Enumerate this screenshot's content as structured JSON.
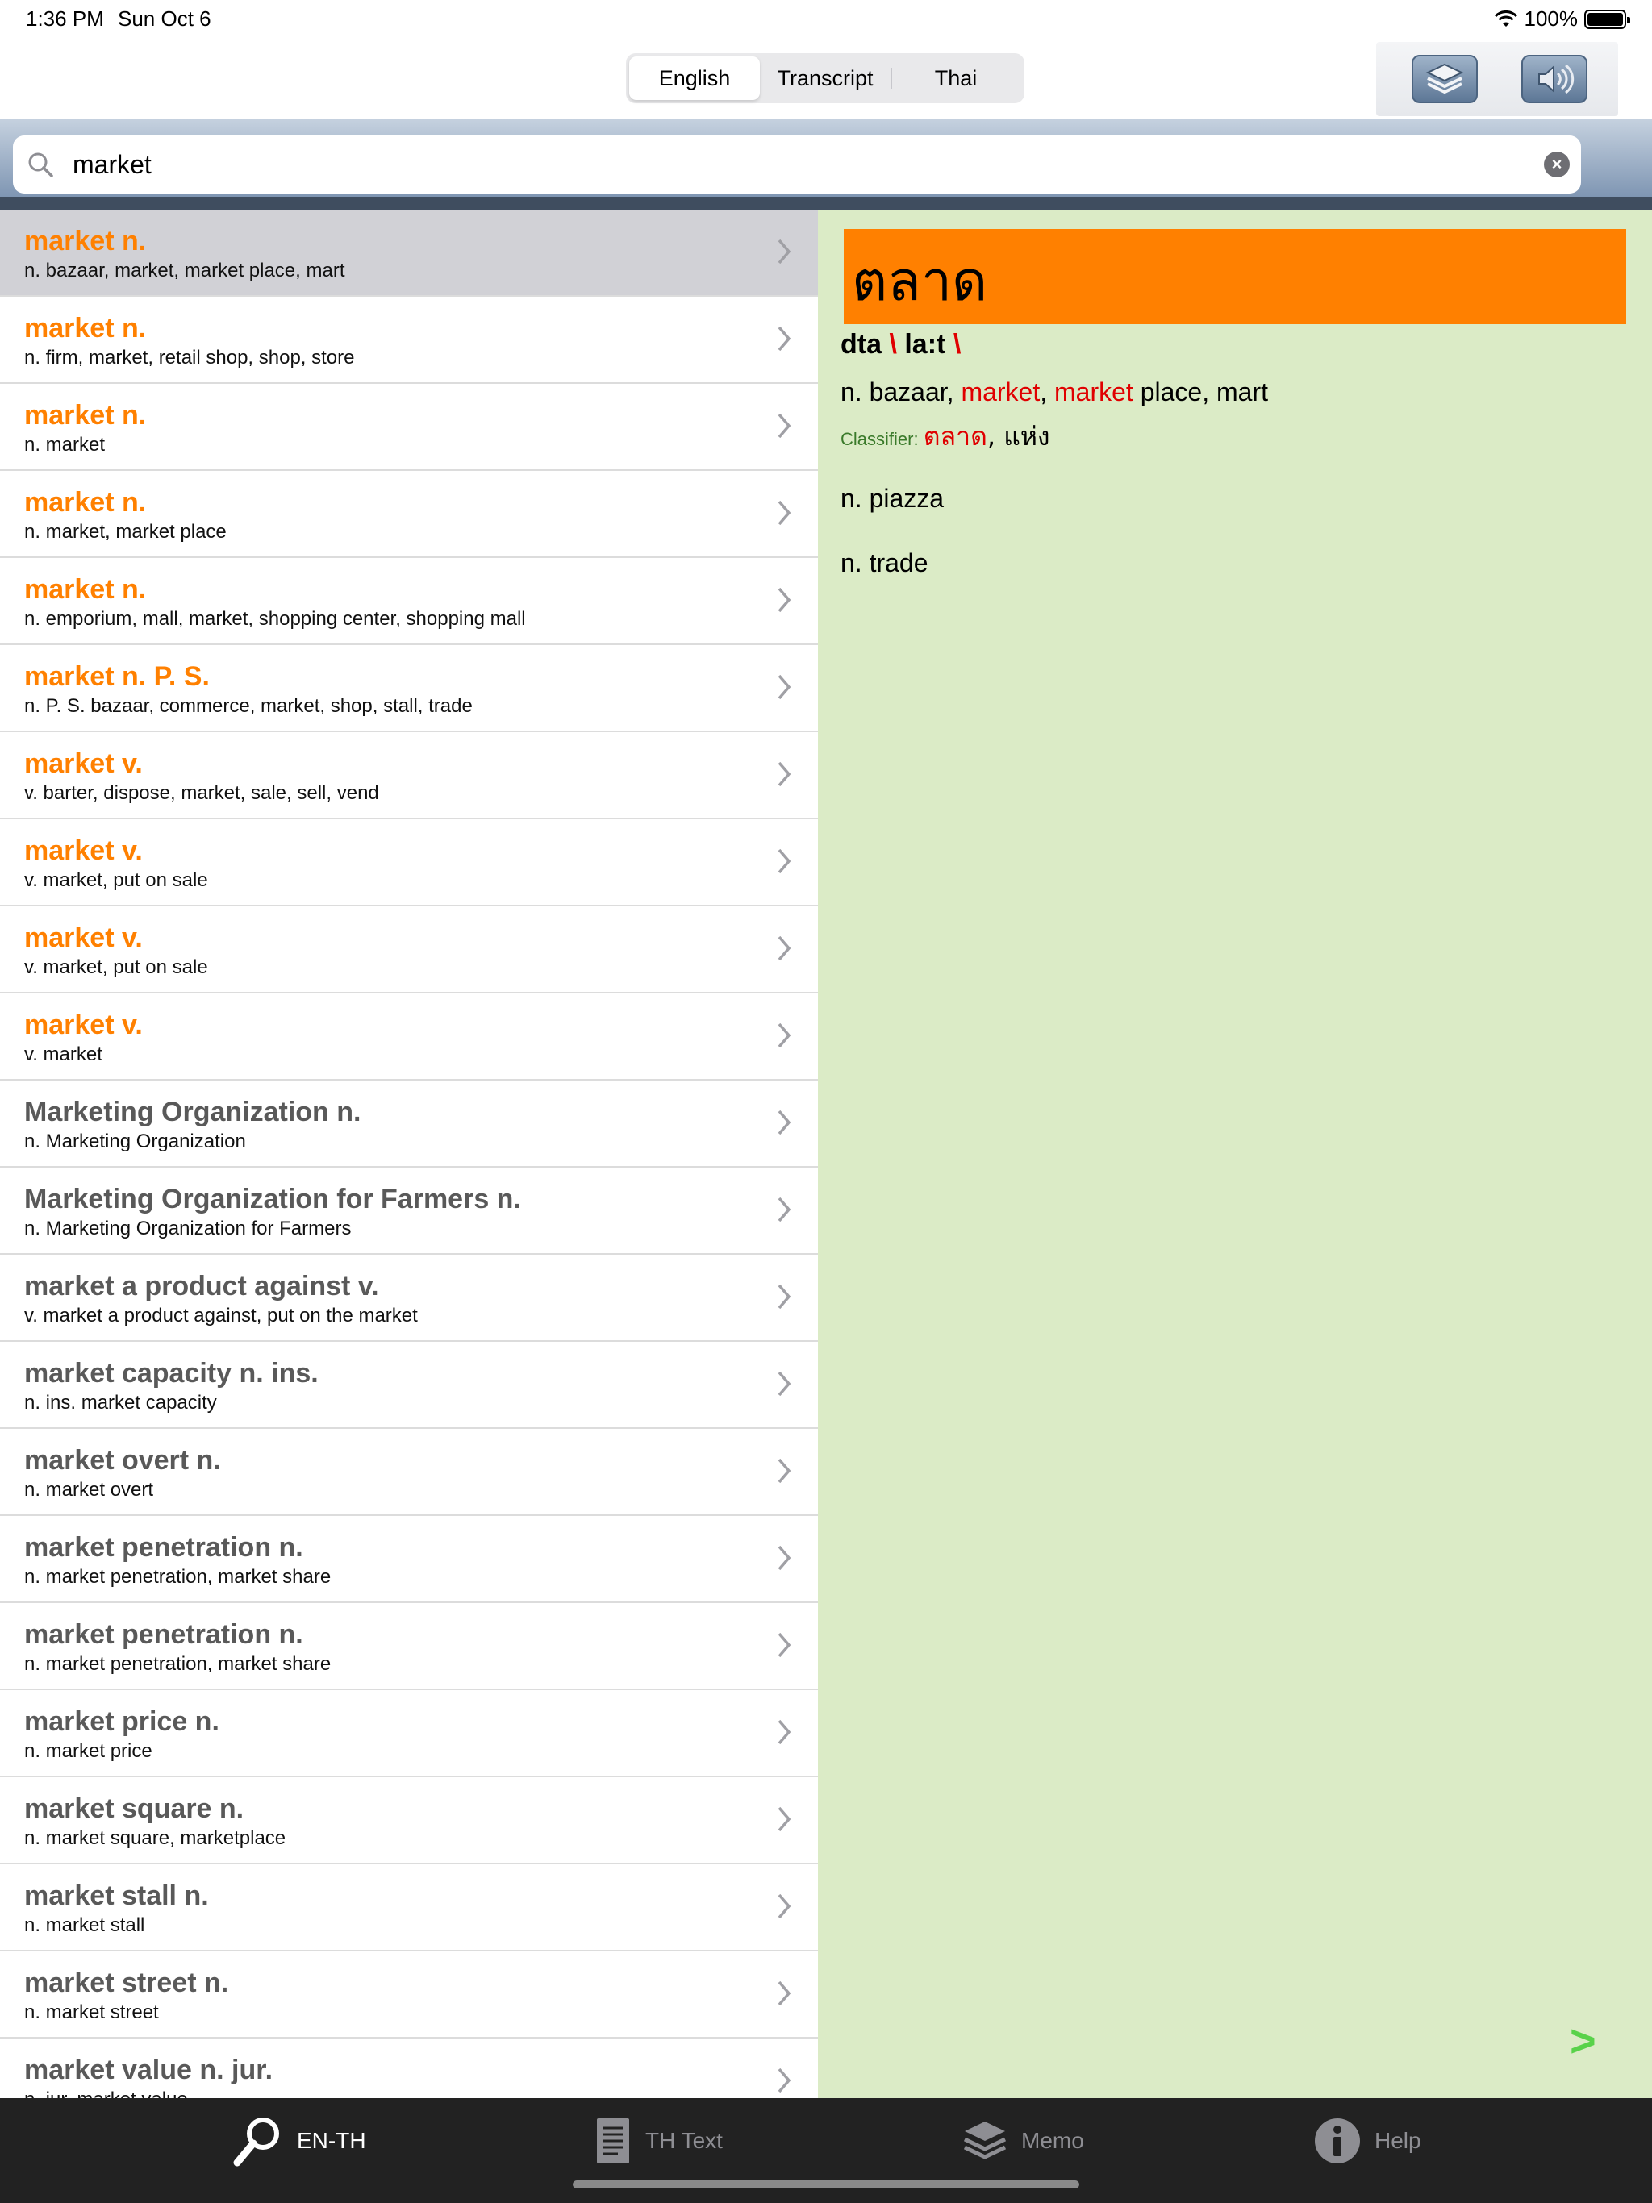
{
  "status": {
    "time": "1:36 PM",
    "date": "Sun Oct 6",
    "battery": "100%"
  },
  "segments": [
    {
      "label": "English",
      "active": true
    },
    {
      "label": "Transcript",
      "active": false
    },
    {
      "label": "Thai",
      "active": false
    }
  ],
  "search": {
    "value": "market",
    "placeholder": ""
  },
  "results": [
    {
      "title": "market n.",
      "sub": "n. bazaar, market, market place, mart",
      "style": "orange",
      "selected": true
    },
    {
      "title": "market n.",
      "sub": "n. firm, market, retail shop, shop, store",
      "style": "orange"
    },
    {
      "title": "market n.",
      "sub": " n. market",
      "style": "orange"
    },
    {
      "title": "market n.",
      "sub": "n. market, market place",
      "style": "orange"
    },
    {
      "title": "market n.",
      "sub": "n. emporium, mall, market, shopping center, shopping mall",
      "style": "orange"
    },
    {
      "title": "market n. P. S.",
      "sub": "n. P. S. bazaar, commerce, market, shop, stall, trade",
      "style": "orange"
    },
    {
      "title": "market v.",
      "sub": "v. barter, dispose, market, sale, sell, vend",
      "style": "orange"
    },
    {
      "title": "market v.",
      "sub": "v. market, put on sale",
      "style": "orange"
    },
    {
      "title": "market v.",
      "sub": "v. market, put on sale",
      "style": "orange"
    },
    {
      "title": "market v.",
      "sub": "v. market",
      "style": "orange"
    },
    {
      "title": "Marketing Organization n.",
      "sub": "n. Marketing Organization",
      "style": "gray"
    },
    {
      "title": "Marketing Organization for Farmers n.",
      "sub": "n. Marketing Organization for Farmers",
      "style": "gray"
    },
    {
      "title": "market a product against v.",
      "sub": "v. market a product against, put on the market",
      "style": "gray"
    },
    {
      "title": "market capacity n. ins.",
      "sub": "n. ins. market capacity",
      "style": "gray"
    },
    {
      "title": "market overt n.",
      "sub": "n. market overt",
      "style": "gray"
    },
    {
      "title": "market penetration n.",
      "sub": "n. market penetration, market share",
      "style": "gray"
    },
    {
      "title": "market penetration n.",
      "sub": "n. market penetration, market share",
      "style": "gray"
    },
    {
      "title": "market price n.",
      "sub": "n. market price",
      "style": "gray"
    },
    {
      "title": "market square n.",
      "sub": "n. market square, marketplace",
      "style": "gray"
    },
    {
      "title": "market stall n.",
      "sub": "n. market stall",
      "style": "gray"
    },
    {
      "title": "market street n.",
      "sub": "n. market street",
      "style": "gray"
    },
    {
      "title": "market value n. jur.",
      "sub": "n. jur. market value",
      "style": "gray"
    }
  ],
  "detail": {
    "headword": "ตลาด",
    "translit_a": "dta",
    "translit_sep": "\\",
    "translit_b": "la:t",
    "def1_a": "n. bazaar, ",
    "def1_hl1": "market",
    "def1_b": ", ",
    "def1_hl2": "market",
    "def1_c": " place, mart",
    "classifier_label": "Classifier:",
    "classifier_thai1": "ตลาด",
    "classifier_sep": ", ",
    "classifier_thai2": "แห่ง",
    "def2": "n. piazza",
    "def3": "n. trade",
    "next": ">"
  },
  "tabs": [
    {
      "label": "EN-TH",
      "icon": "magnifier-icon",
      "active": true
    },
    {
      "label": "TH Text",
      "icon": "document-icon",
      "active": false
    },
    {
      "label": "Memo",
      "icon": "layers-icon",
      "active": false
    },
    {
      "label": "Help",
      "icon": "info-icon",
      "active": false
    }
  ],
  "colors": {
    "accent_orange": "#ff8000",
    "highlight_red": "#e00000",
    "detail_bg": "#dbebc6",
    "tabbar_bg": "#222222"
  }
}
